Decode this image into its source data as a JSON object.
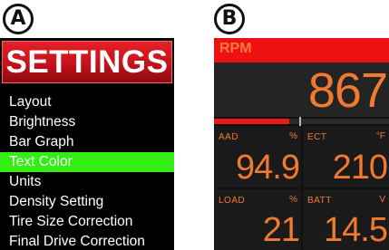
{
  "panels": {
    "a_label": "A",
    "b_label": "B"
  },
  "settings": {
    "title": "SETTINGS",
    "header_color": "#d41a20",
    "highlight_color": "#33ee14",
    "items": [
      {
        "label": "Layout",
        "selected": false
      },
      {
        "label": "Brightness",
        "selected": false
      },
      {
        "label": "Bar Graph",
        "selected": false
      },
      {
        "label": "Text Color",
        "selected": true
      },
      {
        "label": "Units",
        "selected": false
      },
      {
        "label": "Density Setting",
        "selected": false
      },
      {
        "label": "Tire Size Correction",
        "selected": false
      },
      {
        "label": "Final Drive Correction",
        "selected": false
      }
    ]
  },
  "gauges": {
    "text_color": "#f07a30",
    "header_color": "#ee1111",
    "rpm": {
      "label": "RPM",
      "value": "867",
      "bar_fraction": 0.43
    },
    "cells": [
      {
        "label": "AAD",
        "unit": "%",
        "value": "94.9"
      },
      {
        "label": "ECT",
        "unit": "°F",
        "value": "210"
      },
      {
        "label": "LOAD",
        "unit": "%",
        "value": "21"
      },
      {
        "label": "BATT",
        "unit": "V",
        "value": "14.5"
      }
    ]
  }
}
